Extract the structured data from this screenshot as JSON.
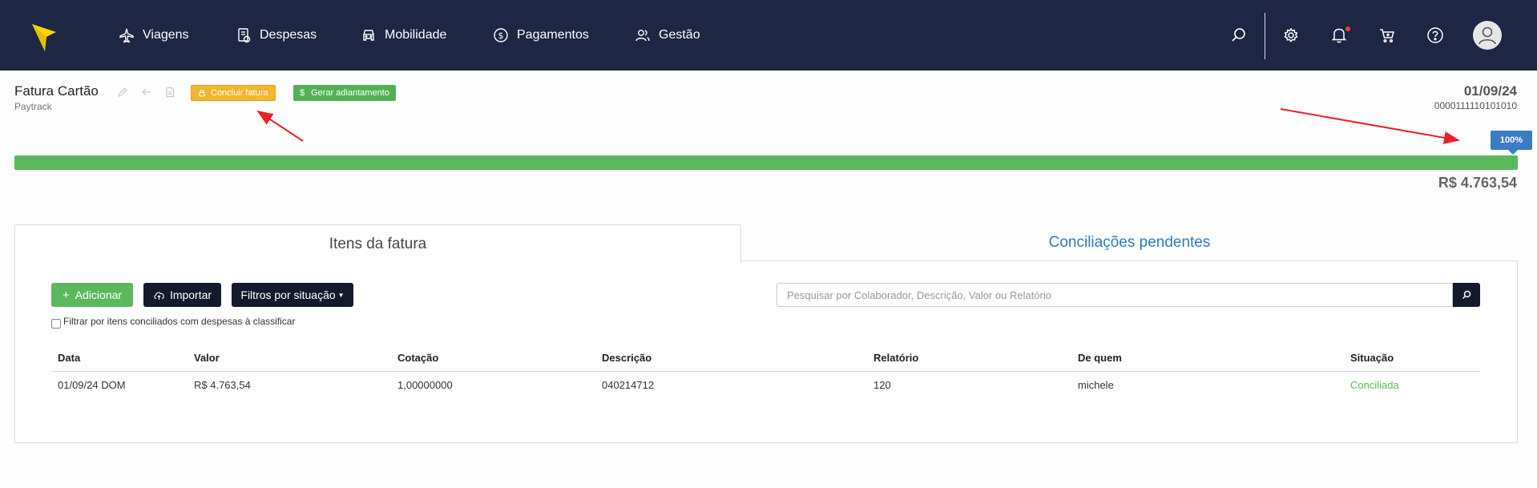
{
  "nav": {
    "items": [
      {
        "label": "Viagens",
        "icon": "plane-icon"
      },
      {
        "label": "Despesas",
        "icon": "receipt-icon"
      },
      {
        "label": "Mobilidade",
        "icon": "car-icon"
      },
      {
        "label": "Pagamentos",
        "icon": "dollar-circle-icon"
      },
      {
        "label": "Gestão",
        "icon": "users-icon"
      }
    ],
    "right_icons": [
      "search-icon",
      "gear-icon",
      "bell-icon",
      "cart-icon",
      "help-icon",
      "user-avatar-icon"
    ],
    "colors": {
      "bar": "#1d2643",
      "logo": "#ffd400",
      "notification": "#ff3b3b"
    }
  },
  "header": {
    "title": "Fatura Cartão",
    "subtitle": "Paytrack",
    "conclude_label": "Concluir fatura",
    "advance_label": "Gerar adiantamento",
    "date": "01/09/24",
    "code": "0000111110101010"
  },
  "progress": {
    "value": 100,
    "label": "100%",
    "total": "R$ 4.763,54",
    "colors": {
      "fill": "#5cb85c",
      "badge": "#3b7dc4"
    }
  },
  "tabs": [
    {
      "label": "Itens da fatura",
      "active": true
    },
    {
      "label": "Conciliações pendentes",
      "active": false
    }
  ],
  "toolbar": {
    "add_label": "Adicionar",
    "import_label": "Importar",
    "filter_label": "Filtros por situação",
    "search_placeholder": "Pesquisar por Colaborador, Descrição, Valor ou Relatório",
    "checkbox_label": "Filtrar por itens conciliados com despesas à classificar"
  },
  "table": {
    "headers": [
      "Data",
      "Valor",
      "Cotação",
      "Descrição",
      "Relatório",
      "De quem",
      "Situação"
    ],
    "rows": [
      [
        "01/09/24 DOM",
        "R$ 4.763,54",
        "1,00000000",
        "040214712",
        "120",
        "michele",
        "Conciliada"
      ]
    ]
  }
}
